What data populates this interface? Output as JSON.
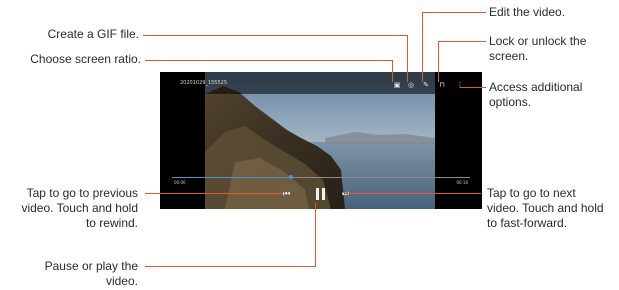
{
  "screen": {
    "filename": "20201029_155525",
    "time_elapsed": "00:00",
    "time_total": "00:16",
    "progress": 0.4
  },
  "callouts": {
    "gif": "Create a GIF file.",
    "ratio": "Choose screen ratio.",
    "edit": "Edit the video.",
    "lock": [
      "Lock or unlock the",
      "screen."
    ],
    "options": [
      "Access additional",
      "options."
    ],
    "previous": [
      "Tap to go to previous",
      "video. Touch and hold",
      "to rewind."
    ],
    "next": [
      "Tap to go to next",
      "video. Touch and hold",
      "to fast-forward."
    ],
    "pause": [
      "Pause or play the",
      "video."
    ]
  },
  "colors": {
    "leader": "#e8562a",
    "progress": "#4e8fe0"
  },
  "icons": {
    "ratio": "screen-ratio-icon",
    "gif": "gif-icon",
    "edit": "edit-icon",
    "lock": "lock-icon",
    "more": "more-options-icon",
    "previous": "previous-icon",
    "pause": "pause-icon",
    "next": "next-icon"
  }
}
